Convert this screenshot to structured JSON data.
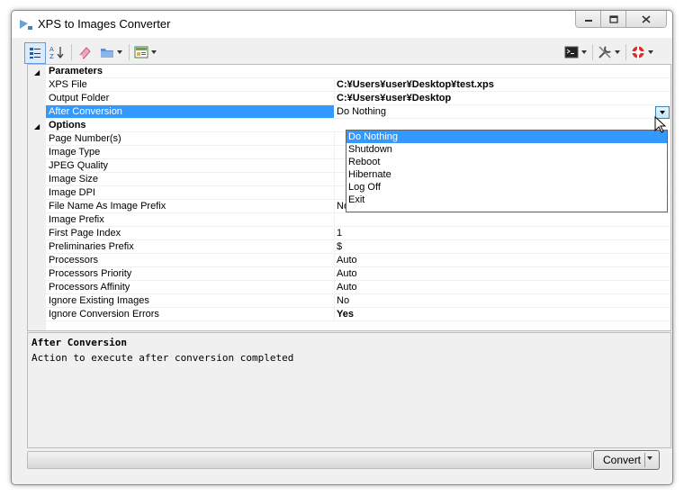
{
  "window": {
    "title": "XPS to Images Converter"
  },
  "toolbar": {
    "left_icons": [
      "categorized-icon",
      "alphabetical-icon",
      "eraser-icon",
      "folder-open-icon",
      "image-settings-icon"
    ],
    "right_icons": [
      "console-icon",
      "tools-icon",
      "help-lifebuoy-icon"
    ]
  },
  "grid": {
    "categories": [
      {
        "name": "Parameters"
      },
      {
        "name": "Options"
      }
    ],
    "parameters": [
      {
        "label": "XPS File",
        "value": "C:¥Users¥user¥Desktop¥test.xps",
        "bold": true
      },
      {
        "label": "Output Folder",
        "value": "C:¥Users¥user¥Desktop",
        "bold": true
      },
      {
        "label": "After Conversion",
        "value": "Do Nothing",
        "bold": false,
        "selected": true
      }
    ],
    "options": [
      {
        "label": "Page Number(s)",
        "value": ""
      },
      {
        "label": "Image Type",
        "value": ""
      },
      {
        "label": "JPEG Quality",
        "value": ""
      },
      {
        "label": "Image Size",
        "value": ""
      },
      {
        "label": "Image DPI",
        "value": ""
      },
      {
        "label": "File Name As Image Prefix",
        "value": "No"
      },
      {
        "label": "Image Prefix",
        "value": ""
      },
      {
        "label": "First Page Index",
        "value": "1"
      },
      {
        "label": "Preliminaries Prefix",
        "value": "$"
      },
      {
        "label": "Processors",
        "value": "Auto"
      },
      {
        "label": "Processors Priority",
        "value": "Auto"
      },
      {
        "label": "Processors Affinity",
        "value": "Auto"
      },
      {
        "label": "Ignore Existing Images",
        "value": "No"
      },
      {
        "label": "Ignore Conversion Errors",
        "value": "Yes",
        "bold": true
      }
    ]
  },
  "dropdown": {
    "options": [
      "Do Nothing",
      "Shutdown",
      "Reboot",
      "Hibernate",
      "Log Off",
      "Exit"
    ],
    "highlighted": 0
  },
  "description": {
    "title": "After Conversion",
    "text": "Action to execute after conversion completed"
  },
  "footer": {
    "progress": 0,
    "convert_label": "Convert"
  },
  "colors": {
    "selection": "#3399ff",
    "window_bg": "#f0f0f0"
  }
}
